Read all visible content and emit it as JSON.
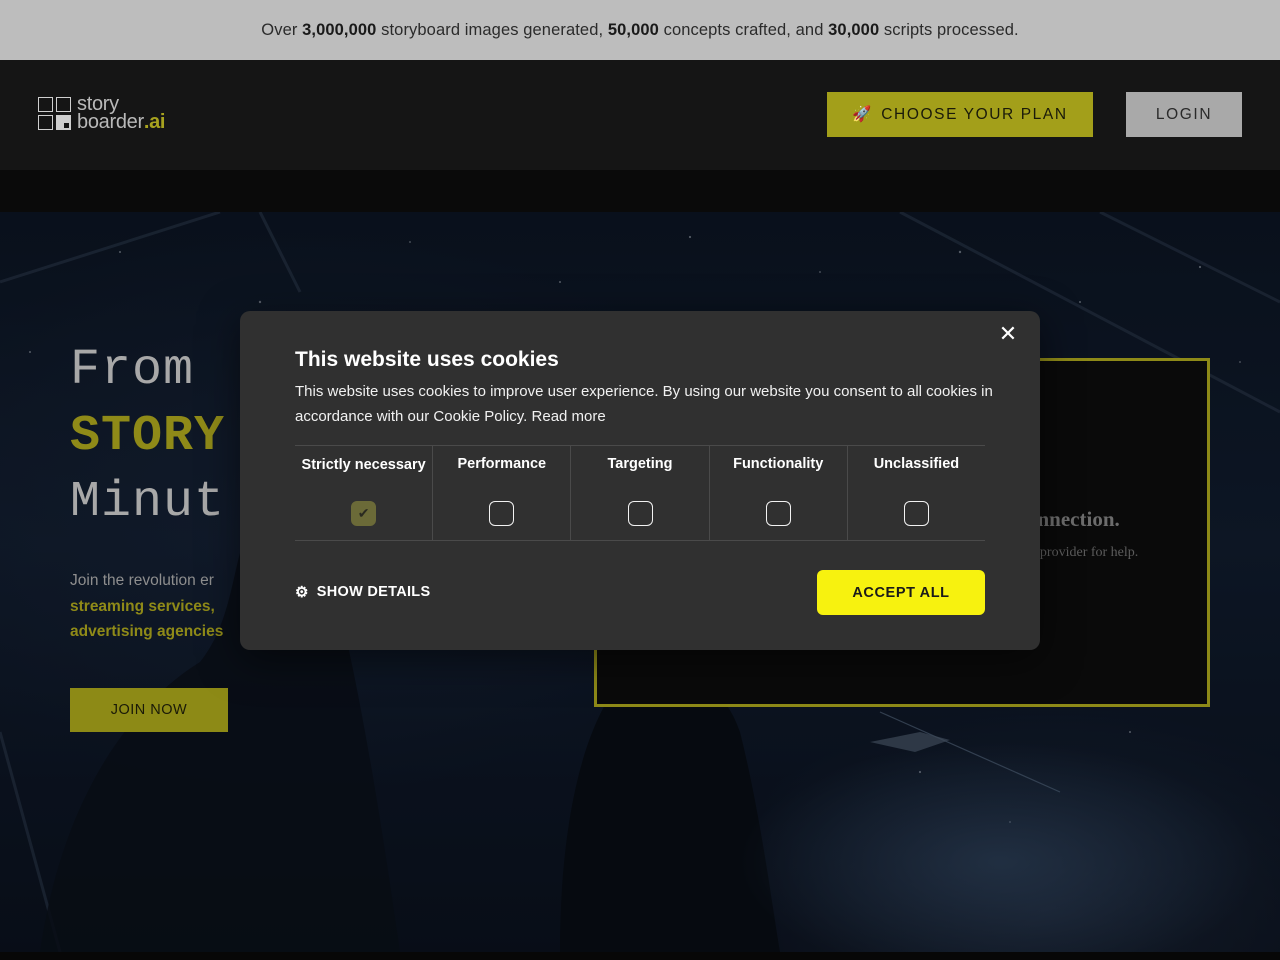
{
  "announcement": {
    "p1": "Over ",
    "n1": "3,000,000",
    "p2": " storyboard images generated, ",
    "n2": "50,000",
    "p3": " concepts crafted, and ",
    "n3": "30,000",
    "p4": " scripts processed."
  },
  "header": {
    "logo_word1": "story",
    "logo_word2": "boarder",
    "logo_suffix": ".ai",
    "plan_icon": "🚀",
    "plan_label": "CHOOSE YOUR PLAN",
    "login_label": "LOGIN"
  },
  "hero": {
    "line1": "From",
    "line2": "STORY",
    "line3": "Minut",
    "para_start": "Join the revolution er",
    "para_hl1": "streaming services,",
    "para_hl2": "advertising agencies",
    "join_label": "JOIN NOW"
  },
  "video": {
    "title": "onnection.",
    "subtitle": "ce provider for help."
  },
  "cookie": {
    "title": "This website uses cookies",
    "description": "This website uses cookies to improve user experience. By using our website you consent to all cookies in accordance with our Cookie Policy.",
    "read_more": "Read more",
    "close_icon": "close-icon",
    "categories": [
      {
        "label": "Strictly necessary",
        "checked": true
      },
      {
        "label": "Performance",
        "checked": false
      },
      {
        "label": "Targeting",
        "checked": false
      },
      {
        "label": "Functionality",
        "checked": false
      },
      {
        "label": "Unclassified",
        "checked": false
      }
    ],
    "show_details": "SHOW DETAILS",
    "accept_all": "ACCEPT ALL"
  },
  "colors": {
    "accent_olive": "#a39f1a",
    "accept_yellow": "#f7f20f",
    "modal_bg": "#303030"
  }
}
